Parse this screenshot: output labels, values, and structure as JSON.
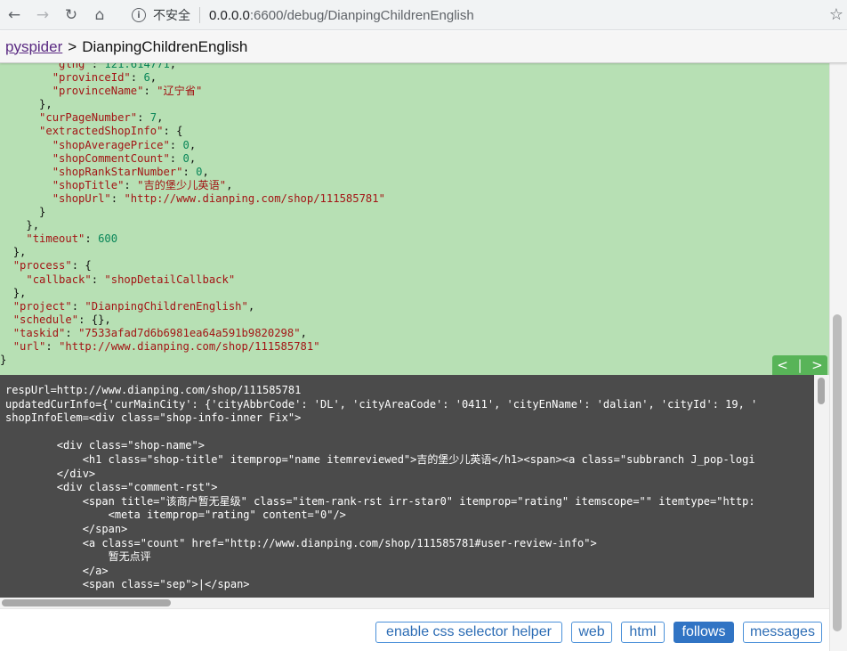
{
  "browser": {
    "back_icon": "back-arrow-icon",
    "forward_icon": "forward-arrow-icon",
    "security_label": "不安全",
    "url_host": "0.0.0.0",
    "url_rest": ":6600/debug/DianpingChildrenEnglish"
  },
  "header": {
    "app_link": "pyspider",
    "separator": ">",
    "project_name": "DianpingChildrenEnglish"
  },
  "task_json": {
    "lines": [
      {
        "indent": "        ",
        "parts": [
          [
            "k",
            "\"glng\""
          ],
          [
            "p",
            ": "
          ],
          [
            "n",
            "121.614771"
          ],
          [
            "p",
            ","
          ]
        ]
      },
      {
        "indent": "        ",
        "parts": [
          [
            "k",
            "\"provinceId\""
          ],
          [
            "p",
            ": "
          ],
          [
            "n",
            "6"
          ],
          [
            "p",
            ","
          ]
        ]
      },
      {
        "indent": "        ",
        "parts": [
          [
            "k",
            "\"provinceName\""
          ],
          [
            "p",
            ": "
          ],
          [
            "s",
            "\"辽宁省\""
          ]
        ]
      },
      {
        "indent": "      ",
        "parts": [
          [
            "p",
            "},"
          ]
        ]
      },
      {
        "indent": "      ",
        "parts": [
          [
            "k",
            "\"curPageNumber\""
          ],
          [
            "p",
            ": "
          ],
          [
            "n",
            "7"
          ],
          [
            "p",
            ","
          ]
        ]
      },
      {
        "indent": "      ",
        "parts": [
          [
            "k",
            "\"extractedShopInfo\""
          ],
          [
            "p",
            ": {"
          ]
        ]
      },
      {
        "indent": "        ",
        "parts": [
          [
            "k",
            "\"shopAveragePrice\""
          ],
          [
            "p",
            ": "
          ],
          [
            "n",
            "0"
          ],
          [
            "p",
            ","
          ]
        ]
      },
      {
        "indent": "        ",
        "parts": [
          [
            "k",
            "\"shopCommentCount\""
          ],
          [
            "p",
            ": "
          ],
          [
            "n",
            "0"
          ],
          [
            "p",
            ","
          ]
        ]
      },
      {
        "indent": "        ",
        "parts": [
          [
            "k",
            "\"shopRankStarNumber\""
          ],
          [
            "p",
            ": "
          ],
          [
            "n",
            "0"
          ],
          [
            "p",
            ","
          ]
        ]
      },
      {
        "indent": "        ",
        "parts": [
          [
            "k",
            "\"shopTitle\""
          ],
          [
            "p",
            ": "
          ],
          [
            "s",
            "\"吉的堡少儿英语\""
          ],
          [
            "p",
            ","
          ]
        ]
      },
      {
        "indent": "        ",
        "parts": [
          [
            "k",
            "\"shopUrl\""
          ],
          [
            "p",
            ": "
          ],
          [
            "s",
            "\"http://www.dianping.com/shop/111585781\""
          ]
        ]
      },
      {
        "indent": "      ",
        "parts": [
          [
            "p",
            "}"
          ]
        ]
      },
      {
        "indent": "    ",
        "parts": [
          [
            "p",
            "},"
          ]
        ]
      },
      {
        "indent": "    ",
        "parts": [
          [
            "k",
            "\"timeout\""
          ],
          [
            "p",
            ": "
          ],
          [
            "n",
            "600"
          ]
        ]
      },
      {
        "indent": "  ",
        "parts": [
          [
            "p",
            "},"
          ]
        ]
      },
      {
        "indent": "  ",
        "parts": [
          [
            "k",
            "\"process\""
          ],
          [
            "p",
            ": {"
          ]
        ]
      },
      {
        "indent": "    ",
        "parts": [
          [
            "k",
            "\"callback\""
          ],
          [
            "p",
            ": "
          ],
          [
            "s",
            "\"shopDetailCallback\""
          ]
        ]
      },
      {
        "indent": "  ",
        "parts": [
          [
            "p",
            "},"
          ]
        ]
      },
      {
        "indent": "  ",
        "parts": [
          [
            "k",
            "\"project\""
          ],
          [
            "p",
            ": "
          ],
          [
            "s",
            "\"DianpingChildrenEnglish\""
          ],
          [
            "p",
            ","
          ]
        ]
      },
      {
        "indent": "  ",
        "parts": [
          [
            "k",
            "\"schedule\""
          ],
          [
            "p",
            ": {},"
          ]
        ]
      },
      {
        "indent": "  ",
        "parts": [
          [
            "k",
            "\"taskid\""
          ],
          [
            "p",
            ": "
          ],
          [
            "s",
            "\"7533afad7d6b6981ea64a591b9820298\""
          ],
          [
            "p",
            ","
          ]
        ]
      },
      {
        "indent": "  ",
        "parts": [
          [
            "k",
            "\"url\""
          ],
          [
            "p",
            ": "
          ],
          [
            "s",
            "\"http://www.dianping.com/shop/111585781\""
          ]
        ]
      },
      {
        "indent": "",
        "parts": [
          [
            "p",
            "}"
          ]
        ]
      }
    ],
    "pager_prev": "<",
    "pager_sep": "|",
    "pager_next": ">"
  },
  "result": {
    "lines": [
      "respUrl=http://www.dianping.com/shop/111585781",
      "updatedCurInfo={'curMainCity': {'cityAbbrCode': 'DL', 'cityAreaCode': '0411', 'cityEnName': 'dalian', 'cityId': 19, '",
      "shopInfoElem=<div class=\"shop-info-inner Fix\">",
      "",
      "        <div class=\"shop-name\">",
      "            <h1 class=\"shop-title\" itemprop=\"name itemreviewed\">吉的堡少儿英语</h1><span><a class=\"subbranch J_pop-logi",
      "        </div>",
      "        <div class=\"comment-rst\">",
      "            <span title=\"该商户暂无星级\" class=\"item-rank-rst irr-star0\" itemprop=\"rating\" itemscope=\"\" itemtype=\"http:",
      "                <meta itemprop=\"rating\" content=\"0\"/>",
      "            </span>",
      "            <a class=\"count\" href=\"http://www.dianping.com/shop/111585781#user-review-info\">",
      "                暂无点评",
      "            </a>",
      "            <span class=\"sep\">|</span>"
    ]
  },
  "toolbar": {
    "css_helper": "enable css selector helper",
    "web": "web",
    "html": "html",
    "follows": "follows",
    "messages": "messages",
    "active_tab": "follows"
  },
  "colors": {
    "task_bg": "#b7e0b4",
    "result_bg": "#4b4b4b",
    "accent": "#3174c4",
    "pager": "#58b458"
  }
}
